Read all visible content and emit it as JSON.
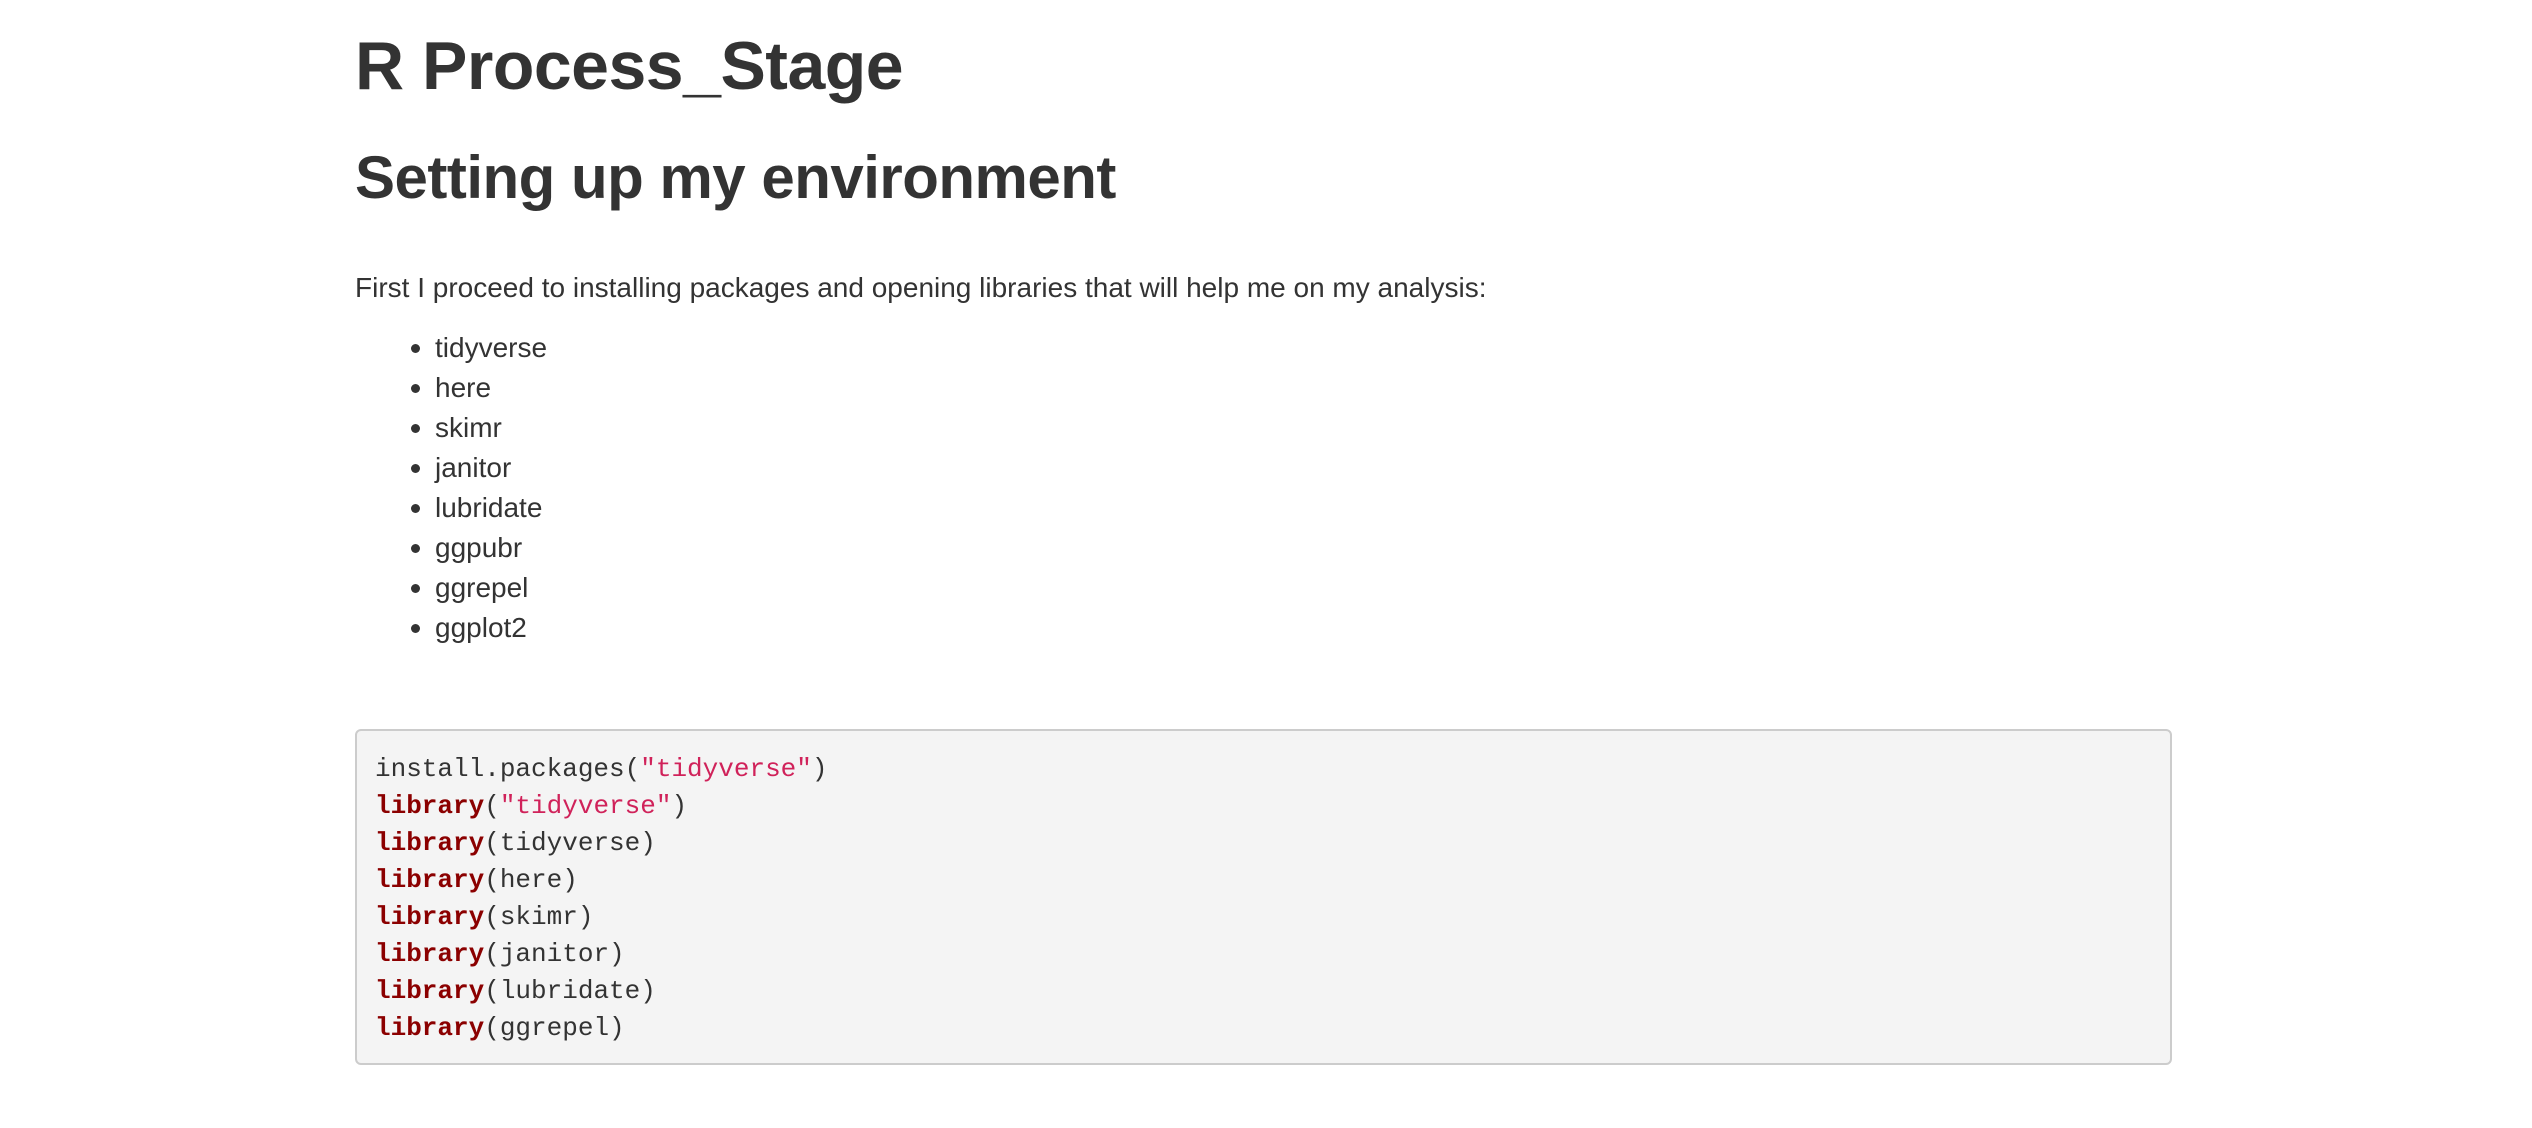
{
  "document": {
    "title": "R Process_Stage",
    "section_heading": "Setting up my environment",
    "intro_text": "First I proceed to installing packages and opening libraries that will help me on my analysis:",
    "packages": [
      "tidyverse",
      "here",
      "skimr",
      "janitor",
      "lubridate",
      "ggpubr",
      "ggrepel",
      "ggplot2"
    ]
  },
  "code": {
    "lines": [
      {
        "fn": "install.packages",
        "open": "(",
        "arg": "\"tidyverse\"",
        "close": ")",
        "fn_is_keyword": false,
        "arg_is_string": true
      },
      {
        "fn": "library",
        "open": "(",
        "arg": "\"tidyverse\"",
        "close": ")",
        "fn_is_keyword": true,
        "arg_is_string": true
      },
      {
        "fn": "library",
        "open": "(",
        "arg": "tidyverse",
        "close": ")",
        "fn_is_keyword": true,
        "arg_is_string": false
      },
      {
        "fn": "library",
        "open": "(",
        "arg": "here",
        "close": ")",
        "fn_is_keyword": true,
        "arg_is_string": false
      },
      {
        "fn": "library",
        "open": "(",
        "arg": "skimr",
        "close": ")",
        "fn_is_keyword": true,
        "arg_is_string": false
      },
      {
        "fn": "library",
        "open": "(",
        "arg": "janitor",
        "close": ")",
        "fn_is_keyword": true,
        "arg_is_string": false
      },
      {
        "fn": "library",
        "open": "(",
        "arg": "lubridate",
        "close": ")",
        "fn_is_keyword": true,
        "arg_is_string": false
      },
      {
        "fn": "library",
        "open": "(",
        "arg": "ggrepel",
        "close": ")",
        "fn_is_keyword": true,
        "arg_is_string": false
      }
    ]
  },
  "colors": {
    "text": "#333333",
    "keyword": "#8b0000",
    "string": "#d0225a",
    "code_background": "#f4f4f4",
    "code_border": "#cccccc"
  }
}
